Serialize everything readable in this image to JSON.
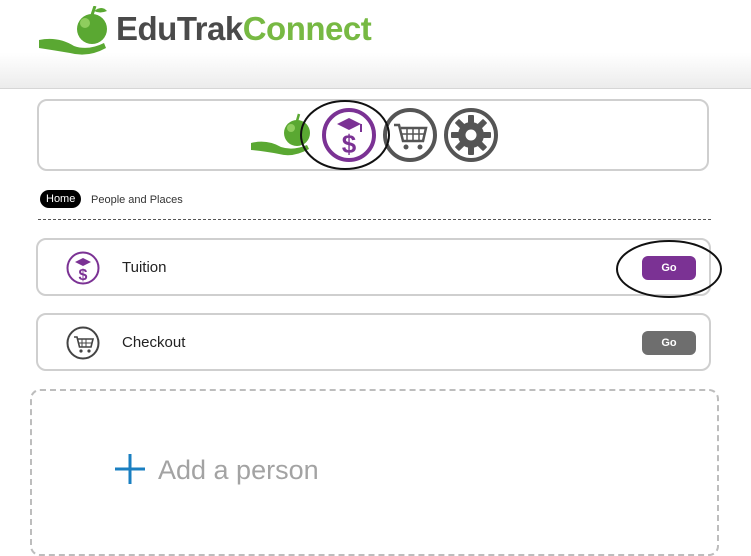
{
  "brand": {
    "part1": "Edu",
    "part2": "Trak",
    "part3": "Connect"
  },
  "icon_panel": {
    "icons": [
      "hand-apple-icon",
      "tuition-dollar-icon",
      "shopping-cart-icon",
      "gear-icon"
    ]
  },
  "breadcrumb": {
    "home": "Home",
    "current": "People and Places"
  },
  "rows": [
    {
      "label": "Tuition",
      "button": "Go",
      "button_color": "#7b3294",
      "icon": "tuition-dollar-icon"
    },
    {
      "label": "Checkout",
      "button": "Go",
      "button_color": "#6e6e6e",
      "icon": "shopping-cart-icon"
    }
  ],
  "add_person": {
    "label": "Add a person",
    "icon": "plus-icon",
    "plus_color": "#1a7fc1"
  },
  "colors": {
    "purple": "#7b3294",
    "green": "#77b943",
    "gray": "#555555"
  }
}
